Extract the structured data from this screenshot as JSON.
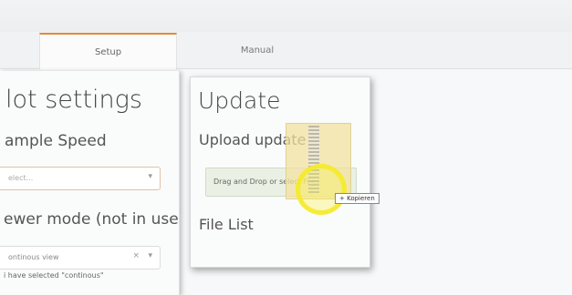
{
  "tabs": {
    "setup": "Setup",
    "manual": "Manual"
  },
  "left_panel": {
    "title": "lot settings",
    "sample_speed": {
      "label": "ample Speed",
      "placeholder": "elect..."
    },
    "viewer_mode": {
      "label": "ewer mode (not in use)",
      "value": "ontinous view",
      "hint": "i have selected \"continous\""
    }
  },
  "update_panel": {
    "title": "Update",
    "upload_label": "Upload update",
    "dropzone_text": "Drag and Drop or select Files",
    "file_list_label": "File List"
  },
  "drag_tooltip": "+ Kopieren"
}
